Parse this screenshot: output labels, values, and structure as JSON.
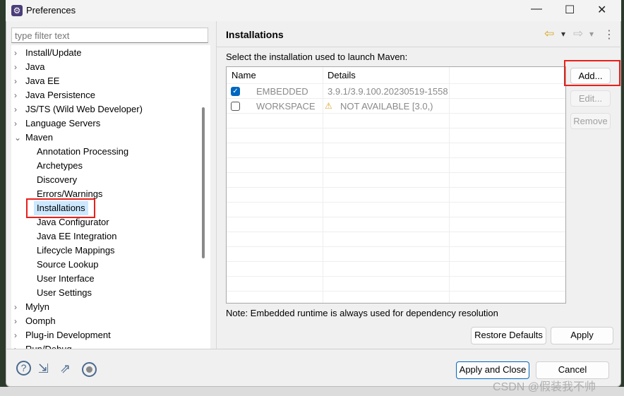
{
  "window": {
    "title": "Preferences",
    "controls": [
      "—",
      "☐",
      "✕"
    ]
  },
  "filter": {
    "placeholder": "type filter text"
  },
  "tree": [
    {
      "label": "Install/Update",
      "level": 0,
      "expander": "›"
    },
    {
      "label": "Java",
      "level": 0,
      "expander": "›"
    },
    {
      "label": "Java EE",
      "level": 0,
      "expander": "›"
    },
    {
      "label": "Java Persistence",
      "level": 0,
      "expander": "›"
    },
    {
      "label": "JS/TS (Wild Web Developer)",
      "level": 0,
      "expander": "›"
    },
    {
      "label": "Language Servers",
      "level": 0,
      "expander": "›"
    },
    {
      "label": "Maven",
      "level": 0,
      "expander": "⌄"
    },
    {
      "label": "Annotation Processing",
      "level": 1
    },
    {
      "label": "Archetypes",
      "level": 1
    },
    {
      "label": "Discovery",
      "level": 1
    },
    {
      "label": "Errors/Warnings",
      "level": 1
    },
    {
      "label": "Installations",
      "level": 1,
      "selected": true
    },
    {
      "label": "Java Configurator",
      "level": 1
    },
    {
      "label": "Java EE Integration",
      "level": 1
    },
    {
      "label": "Lifecycle Mappings",
      "level": 1
    },
    {
      "label": "Source Lookup",
      "level": 1
    },
    {
      "label": "User Interface",
      "level": 1
    },
    {
      "label": "User Settings",
      "level": 1
    },
    {
      "label": "Mylyn",
      "level": 0,
      "expander": "›"
    },
    {
      "label": "Oomph",
      "level": 0,
      "expander": "›"
    },
    {
      "label": "Plug-in Development",
      "level": 0,
      "expander": "›"
    },
    {
      "label": "Run/Debug",
      "level": 0,
      "expander": "›"
    }
  ],
  "page": {
    "title": "Installations",
    "nav": {
      "back": "⇦",
      "dropdown": "▾",
      "forward": "⇨",
      "menu": "⋮"
    },
    "instruction": "Select the installation used to launch Maven:",
    "columns": [
      "Name",
      "Details"
    ],
    "rows": [
      {
        "checked": true,
        "name": "EMBEDDED",
        "details": "3.9.1/3.9.100.20230519-1558",
        "warning": false
      },
      {
        "checked": false,
        "name": "WORKSPACE",
        "details": "NOT AVAILABLE [3.0,)",
        "warning": true
      }
    ],
    "buttons": {
      "add": "Add...",
      "edit": "Edit...",
      "remove": "Remove"
    },
    "note": "Note: Embedded runtime is always used for dependency resolution",
    "restore_defaults": "Restore Defaults",
    "apply": "Apply"
  },
  "footer": {
    "apply_close": "Apply and Close",
    "cancel": "Cancel"
  },
  "watermark": "CSDN @假装我不帅",
  "colors": {
    "highlight": "#e8201a",
    "selection": "#cce8ff",
    "checkbox": "#0067c0"
  }
}
